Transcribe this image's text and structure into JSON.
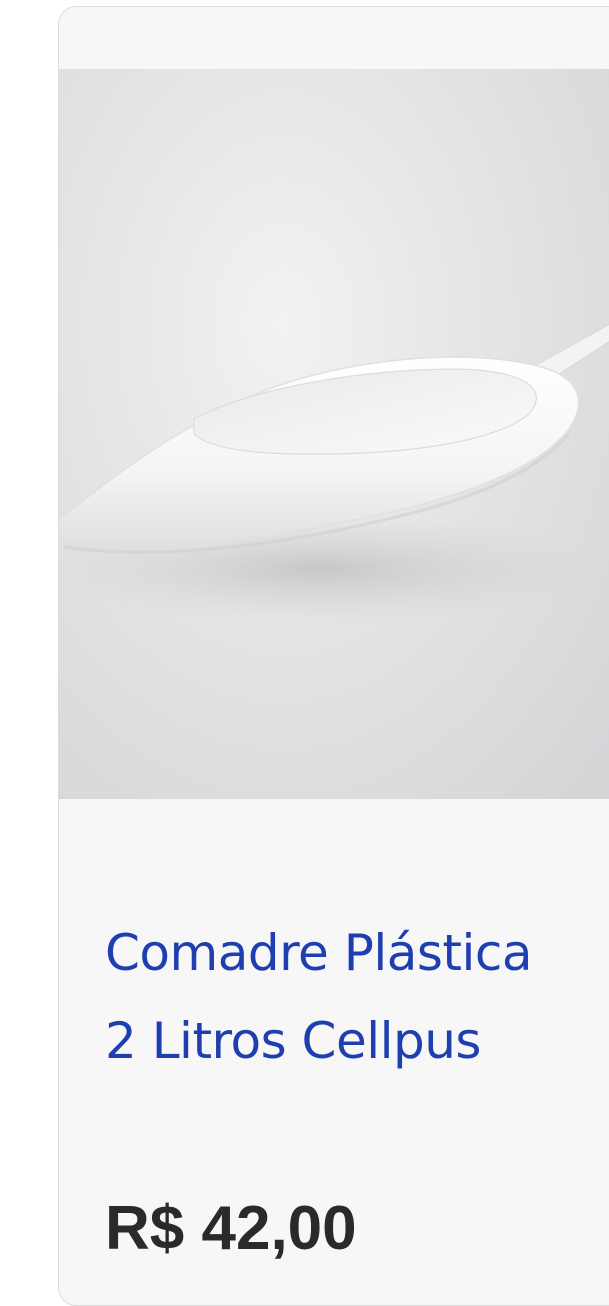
{
  "product": {
    "image_alt": "Comadre Plástica 2 Litros Cellpus",
    "title": "Comadre Plástica 2 Litros Cellpus",
    "price": "R$ 42,00"
  },
  "colors": {
    "title": "#1f3fb0",
    "price": "#2a2a2a",
    "card_background": "#f7f7f8",
    "card_border": "#dcdcde"
  }
}
